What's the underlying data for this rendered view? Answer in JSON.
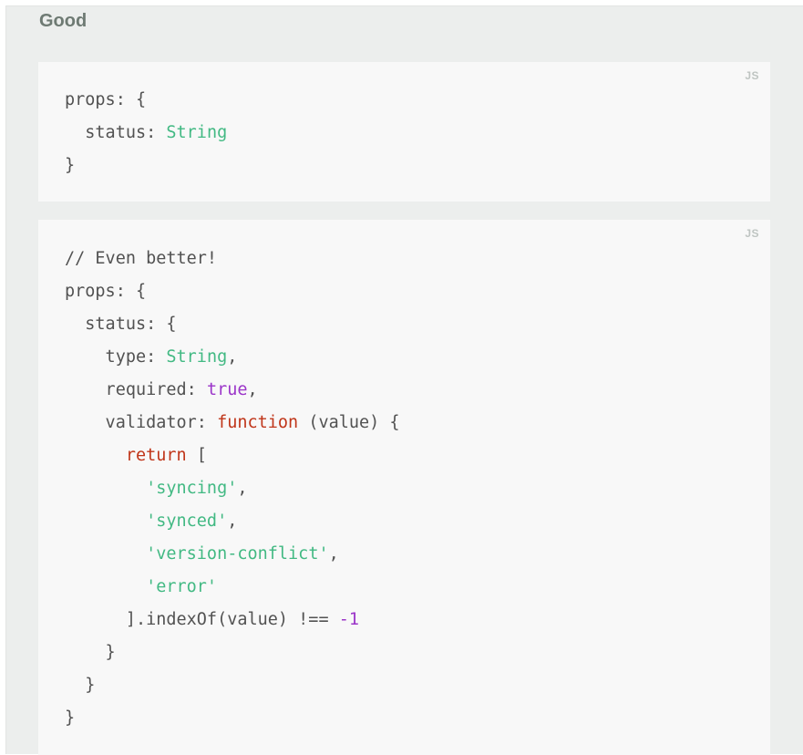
{
  "section": {
    "title": "Good"
  },
  "code_blocks": [
    {
      "language": "JS",
      "lines": [
        [
          {
            "t": "props: {",
            "c": "pun"
          }
        ],
        [
          {
            "t": "  status: ",
            "c": "pun"
          },
          {
            "t": "String",
            "c": "str"
          }
        ],
        [
          {
            "t": "}",
            "c": "pun"
          }
        ]
      ]
    },
    {
      "language": "JS",
      "lines": [
        [
          {
            "t": "// Even better!",
            "c": "com"
          }
        ],
        [
          {
            "t": "props: {",
            "c": "pun"
          }
        ],
        [
          {
            "t": "  status: {",
            "c": "pun"
          }
        ],
        [
          {
            "t": "    type: ",
            "c": "pun"
          },
          {
            "t": "String",
            "c": "str"
          },
          {
            "t": ",",
            "c": "pun"
          }
        ],
        [
          {
            "t": "    required: ",
            "c": "pun"
          },
          {
            "t": "true",
            "c": "bool"
          },
          {
            "t": ",",
            "c": "pun"
          }
        ],
        [
          {
            "t": "    validator: ",
            "c": "pun"
          },
          {
            "t": "function",
            "c": "kw"
          },
          {
            "t": " (value) {",
            "c": "pun"
          }
        ],
        [
          {
            "t": "      ",
            "c": "pun"
          },
          {
            "t": "return",
            "c": "kw"
          },
          {
            "t": " [",
            "c": "pun"
          }
        ],
        [
          {
            "t": "        ",
            "c": "pun"
          },
          {
            "t": "'syncing'",
            "c": "str"
          },
          {
            "t": ",",
            "c": "pun"
          }
        ],
        [
          {
            "t": "        ",
            "c": "pun"
          },
          {
            "t": "'synced'",
            "c": "str"
          },
          {
            "t": ",",
            "c": "pun"
          }
        ],
        [
          {
            "t": "        ",
            "c": "pun"
          },
          {
            "t": "'version-conflict'",
            "c": "str"
          },
          {
            "t": ",",
            "c": "pun"
          }
        ],
        [
          {
            "t": "        ",
            "c": "pun"
          },
          {
            "t": "'error'",
            "c": "str"
          }
        ],
        [
          {
            "t": "      ].indexOf(value) !== ",
            "c": "pun"
          },
          {
            "t": "-1",
            "c": "num"
          }
        ],
        [
          {
            "t": "    }",
            "c": "pun"
          }
        ],
        [
          {
            "t": "  }",
            "c": "pun"
          }
        ],
        [
          {
            "t": "}",
            "c": "pun"
          }
        ]
      ]
    }
  ],
  "colors": {
    "string": "#42b983",
    "keyword": "#c0361a",
    "literal": "#9b35c9",
    "text": "#525252",
    "heading": "#6e7a73",
    "panel_bg": "#eceeed",
    "code_bg": "#f8f8f8"
  }
}
